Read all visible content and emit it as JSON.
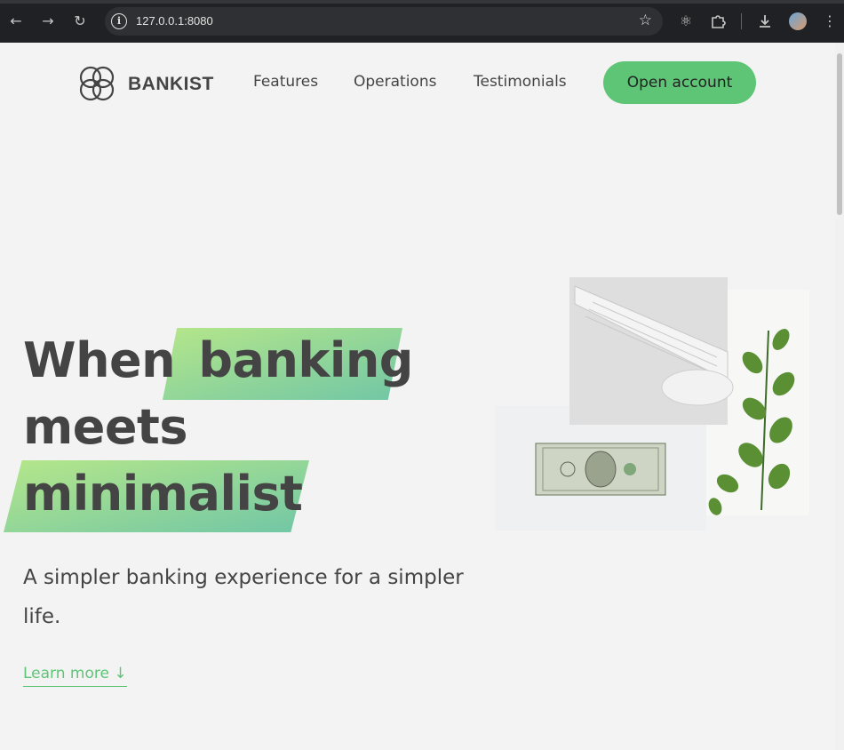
{
  "browser": {
    "url": "127.0.0.1:8080",
    "icons": [
      "back-arrow-icon",
      "forward-arrow-icon",
      "reload-icon",
      "site-info-icon",
      "bookmark-star-icon",
      "react-devtools-icon",
      "extensions-icon",
      "downloads-icon",
      "profile-avatar",
      "menu-kebab-icon"
    ]
  },
  "nav": {
    "brand": "BANKIST",
    "links": [
      "Features",
      "Operations",
      "Testimonials"
    ],
    "cta": "Open account"
  },
  "hero": {
    "line1_plain": "When",
    "line1_highlight": "banking",
    "line2": "meets",
    "line3_highlight": "minimalist",
    "subtitle": "A simpler banking experience for a simpler life.",
    "learn_more": "Learn more ↓"
  },
  "colors": {
    "accent": "#5ec576",
    "highlight_start": "#9be15d",
    "highlight_end": "#39b385",
    "text": "#444444",
    "background": "#f3f3f3"
  }
}
